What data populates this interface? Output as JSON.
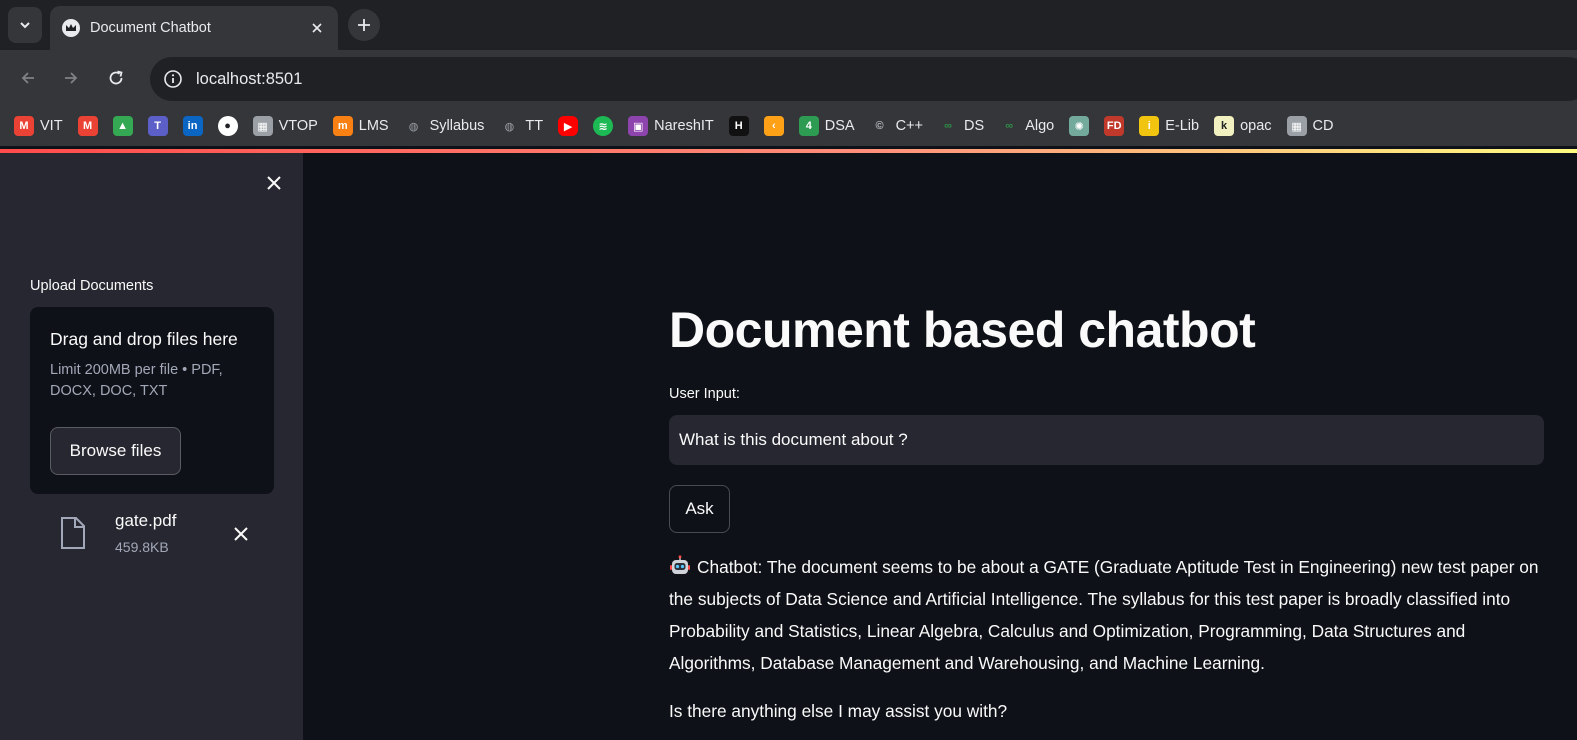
{
  "browser": {
    "tab_title": "Document Chatbot",
    "url": "localhost:8501",
    "bookmarks": [
      {
        "label": "VIT",
        "icon": "gmail-icon",
        "color": "#ea4335"
      },
      {
        "label": "",
        "icon": "gmail-icon",
        "color": "#ea4335"
      },
      {
        "label": "",
        "icon": "google-drive-icon",
        "color": "#34a853"
      },
      {
        "label": "",
        "icon": "teams-icon",
        "color": "#5b5fc7"
      },
      {
        "label": "",
        "icon": "linkedin-icon",
        "color": "#0a66c2"
      },
      {
        "label": "",
        "icon": "github-icon",
        "color": "#ffffff"
      },
      {
        "label": "VTOP",
        "icon": "vtop-icon",
        "color": "#9aa0a6"
      },
      {
        "label": "LMS",
        "icon": "moodle-icon",
        "color": "#f98012"
      },
      {
        "label": "Syllabus",
        "icon": "globe-icon",
        "color": "#9aa0a6"
      },
      {
        "label": "TT",
        "icon": "globe-icon",
        "color": "#9aa0a6"
      },
      {
        "label": "",
        "icon": "youtube-icon",
        "color": "#ff0000"
      },
      {
        "label": "",
        "icon": "spotify-icon",
        "color": "#1db954"
      },
      {
        "label": "NareshIT",
        "icon": "nareshit-icon",
        "color": "#8e44ad"
      },
      {
        "label": "",
        "icon": "hackerrank-icon",
        "color": "#111111"
      },
      {
        "label": "",
        "icon": "leetcode-icon",
        "color": "#ffa116"
      },
      {
        "label": "DSA",
        "icon": "dsa-icon",
        "color": "#2e9b52"
      },
      {
        "label": "C++",
        "icon": "cpp-icon",
        "color": "#bdc1c6"
      },
      {
        "label": "DS",
        "icon": "gfg-icon",
        "color": "#2f8d46"
      },
      {
        "label": "Algo",
        "icon": "gfg-icon",
        "color": "#2f8d46"
      },
      {
        "label": "",
        "icon": "chatgpt-icon",
        "color": "#74aa9c"
      },
      {
        "label": "",
        "icon": "fd-icon",
        "color": "#c0392b"
      },
      {
        "label": "E-Lib",
        "icon": "elib-icon",
        "color": "#f1c40f"
      },
      {
        "label": "opac",
        "icon": "koha-icon",
        "color": "#f0f0c0"
      },
      {
        "label": "CD",
        "icon": "cd-icon",
        "color": "#9aa0a6"
      }
    ]
  },
  "sidebar": {
    "upload_label": "Upload Documents",
    "dropzone_title": "Drag and drop files here",
    "dropzone_limit": "Limit 200MB per file • PDF, DOCX, DOC, TXT",
    "browse_label": "Browse files",
    "file": {
      "name": "gate.pdf",
      "size": "459.8KB"
    }
  },
  "main": {
    "title": "Document based chatbot",
    "input_label": "User Input:",
    "input_value": "What is this document about ?",
    "ask_label": "Ask",
    "response": "Chatbot: The document seems to be about a GATE (Graduate Aptitude Test in Engineering) new test paper on the subjects of Data Science and Artificial Intelligence. The syllabus for this test paper is broadly classified into Probability and Statistics, Linear Algebra, Calculus and Optimization, Programming, Data Structures and Algorithms, Database Management and Warehousing, and Machine Learning.",
    "followup": "Is there anything else I may assist you with?"
  },
  "colors": {
    "app_background": "#0e1117",
    "sidebar_background": "#262730",
    "accent_gradient_start": "#ff4b4b",
    "accent_gradient_end": "#fffd80"
  }
}
